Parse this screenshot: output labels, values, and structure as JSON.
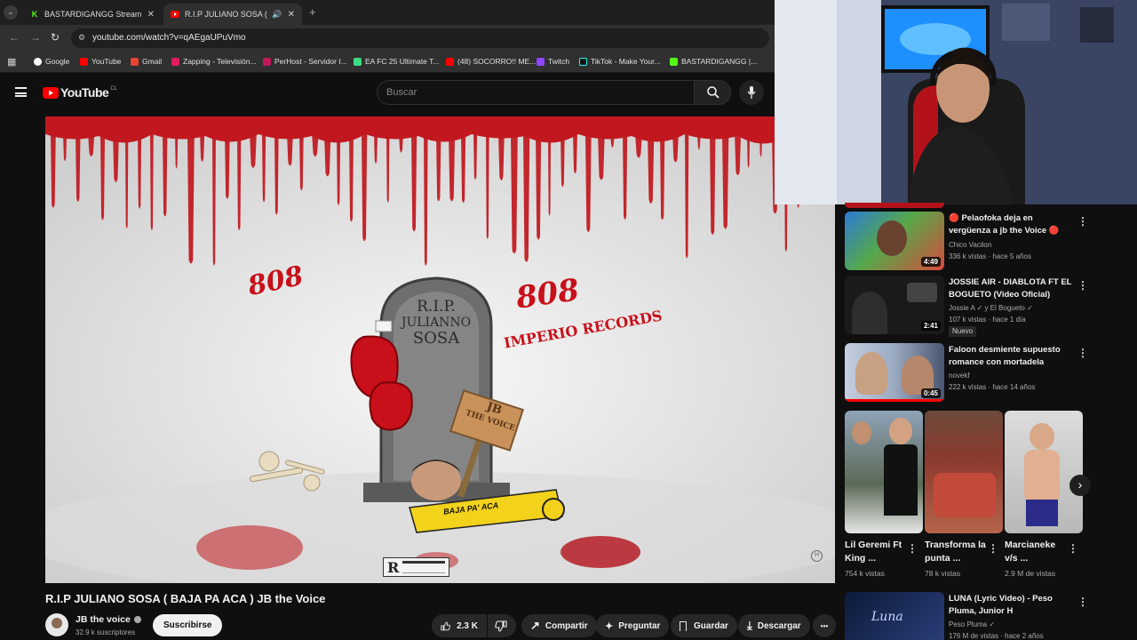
{
  "browser": {
    "tabs": [
      {
        "label": "BASTARDIGANGG Stream - Wa",
        "close": "✕"
      },
      {
        "label": "R.I.P JULIANO SOSA ( BAJA",
        "close": "✕"
      }
    ],
    "new_tab": "+",
    "url": "youtube.com/watch?v=qAEgaUPuVmo",
    "bookmarks": [
      "Google",
      "YouTube",
      "Gmail",
      "Zapping - Televisión...",
      "PerHost - Servidor I...",
      "EA FC 25 Ultimate T...",
      "(48) SOCORRO!! ME...",
      "Twitch",
      "TikTok - Make Your...",
      "BASTARDIGANGG |..."
    ]
  },
  "youtube": {
    "logo": "YouTube",
    "country": "CL",
    "search_placeholder": "Buscar"
  },
  "video": {
    "title": "R.I.P JULIANO SOSA ( BAJA PA ACA ) JB the Voice",
    "channel": "JB the voice",
    "subscribers": "32.9 k suscriptores",
    "subscribe": "Suscribirse",
    "likes": "2.3 K",
    "share": "Compartir",
    "ask": "Preguntar",
    "save": "Guardar",
    "download": "Descargar",
    "more": "•••",
    "art_808_left": "808",
    "art_808_right": "808",
    "art_imperio": "IMPERIO RECORDS",
    "art_rip": "R.I.P.",
    "art_name1": "JULIANNO",
    "art_name2": "SOSA",
    "art_sign1": "JB",
    "art_sign2": "THE VOICE",
    "art_tape": "BAJA PA' ACA",
    "art_badge": "R"
  },
  "sidebar": {
    "items": [
      {
        "title": "🔴 Pelaofoka deja en vergüenza a jb the Voice 🔴",
        "channel": "Chico Vacilon",
        "meta": "336 k vistas · hace 5 años",
        "duration": "4:49"
      },
      {
        "title": "JOSSIE AIR - DIABLOTA FT EL BOGUETO  (Video Oficial)",
        "channel": "Jossie A ✓ y El Bogueto ✓",
        "meta": "107 k vistas · hace 1 día",
        "badge": "Nuevo",
        "duration": "2:41"
      },
      {
        "title": "Faloon desmiente supuesto romance con mortadela",
        "channel": "novekf",
        "meta": "222 k vistas · hace 14 años",
        "duration": "0:45"
      },
      {
        "title": "LUNA (Lyric Video) - Peso Pluma, Junior H",
        "channel": "Peso Pluma ✓",
        "meta": "176 M de vistas · hace 2 años",
        "duration": ""
      }
    ],
    "shorts": [
      {
        "title": "Lil Geremi Ft King ...",
        "views": "754 k vistas"
      },
      {
        "title": "Transforma la punta ...",
        "views": "78 k vistas"
      },
      {
        "title": "Marcianeke v/s ...",
        "views": "2.9 M de vistas"
      }
    ]
  },
  "colors": {
    "accent": "#ff0000",
    "blood": "#c0181e",
    "bg": "#0f0f0f"
  }
}
